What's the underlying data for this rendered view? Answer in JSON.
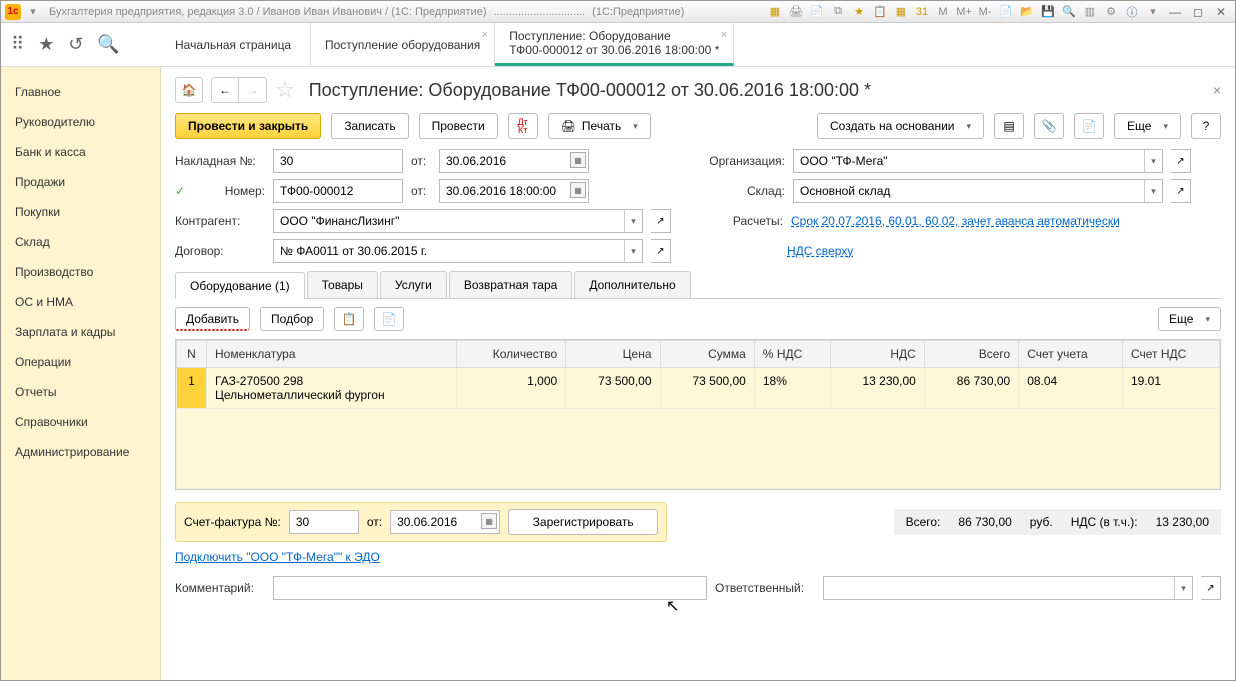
{
  "title_parts": {
    "app": "Бухгалтерия предприятия, редакция 3.0 / Иванов Иван Иванович / (1С: Предприятие)",
    "suffix": "(1С:Предприятие)"
  },
  "tabs": [
    {
      "l1": "Начальная страница"
    },
    {
      "l1": "Поступление оборудования"
    },
    {
      "l1": "Поступление: Оборудование",
      "l2": "ТФ00-000012 от 30.06.2016 18:00:00 *",
      "active": true
    }
  ],
  "sidebar": [
    "Главное",
    "Руководителю",
    "Банк и касса",
    "Продажи",
    "Покупки",
    "Склад",
    "Производство",
    "ОС и НМА",
    "Зарплата и кадры",
    "Операции",
    "Отчеты",
    "Справочники",
    "Администрирование"
  ],
  "page_title": "Поступление: Оборудование ТФ00-000012 от 30.06.2016 18:00:00 *",
  "cmd": {
    "post_close": "Провести и закрыть",
    "write": "Записать",
    "post": "Провести",
    "print": "Печать",
    "create_based": "Создать на основании",
    "more": "Еще"
  },
  "form": {
    "invoice_no_lbl": "Накладная  №:",
    "invoice_no": "30",
    "from": "от:",
    "invoice_date": "30.06.2016",
    "number_lbl": "Номер:",
    "number": "ТФ00-000012",
    "datetime": "30.06.2016 18:00:00",
    "org_lbl": "Организация:",
    "org": "ООО \"ТФ-Мега\"",
    "warehouse_lbl": "Склад:",
    "warehouse": "Основной склад",
    "counterparty_lbl": "Контрагент:",
    "counterparty": "ООО \"ФинансЛизинг\"",
    "calc_lbl": "Расчеты:",
    "calc_link": "Срок 20.07.2016, 60.01, 60.02, зачет аванса автоматически",
    "contract_lbl": "Договор:",
    "contract": "№ ФА0011 от 30.06.2015 г.",
    "vat_link": "НДС сверху"
  },
  "innertabs": [
    "Оборудование (1)",
    "Товары",
    "Услуги",
    "Возвратная тара",
    "Дополнительно"
  ],
  "grid_cmd": {
    "add": "Добавить",
    "pick": "Подбор",
    "more": "Еще"
  },
  "cols": [
    "N",
    "Номенклатура",
    "Количество",
    "Цена",
    "Сумма",
    "% НДС",
    "НДС",
    "Всего",
    "Счет учета",
    "Счет НДС"
  ],
  "row": {
    "n": "1",
    "nom1": "ГАЗ-270500 298",
    "nom2": "Цельнометаллический фургон",
    "qty": "1,000",
    "price": "73 500,00",
    "sum": "73 500,00",
    "vat_pct": "18%",
    "vat": "13 230,00",
    "total": "86 730,00",
    "acct": "08.04",
    "vat_acct": "19.01"
  },
  "invoice": {
    "lbl": "Счет-фактура №:",
    "no": "30",
    "from": "от:",
    "date": "30.06.2016",
    "register": "Зарегистрировать"
  },
  "totals": {
    "total_lbl": "Всего:",
    "total": "86 730,00",
    "cur": "руб.",
    "vat_lbl": "НДС (в т.ч.):",
    "vat": "13 230,00"
  },
  "edo_link": "Подключить \"ООО \"ТФ-Мега\"\" к ЭДО",
  "comment_lbl": "Комментарий:",
  "resp_lbl": "Ответственный:"
}
